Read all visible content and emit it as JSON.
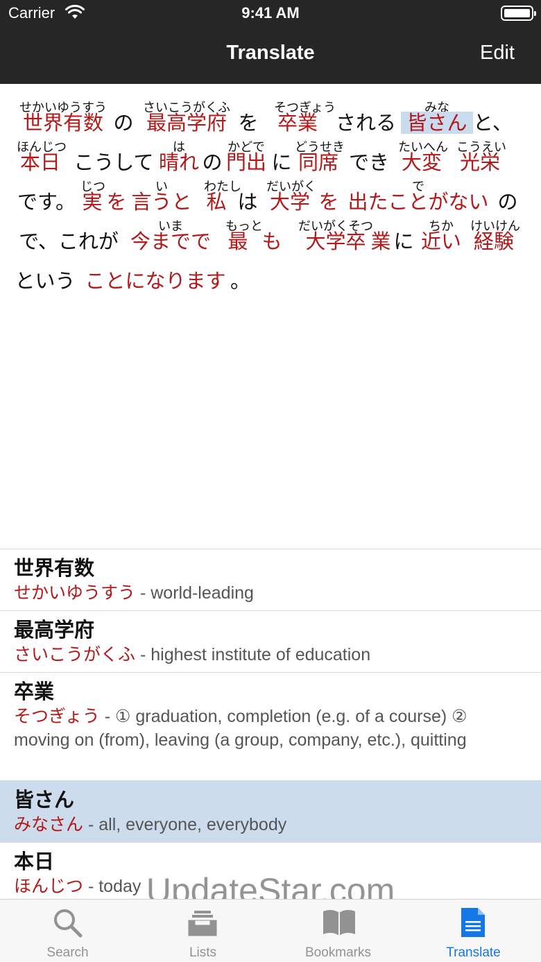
{
  "status_bar": {
    "carrier": "Carrier",
    "time": "9:41 AM"
  },
  "nav": {
    "title": "Translate",
    "edit_label": "Edit"
  },
  "passage": {
    "lines": [
      [
        {
          "text": "世界有数",
          "ruby": "せかいゆうすう",
          "kind": "word"
        },
        {
          "text": "の",
          "kind": "plain"
        },
        {
          "text": "最高学府",
          "ruby": "さいこうがくふ",
          "kind": "word"
        },
        {
          "text": "を",
          "kind": "plain"
        },
        {
          "text": "卒業",
          "ruby": "そつぎょう",
          "kind": "word"
        },
        {
          "text": "される",
          "kind": "plain"
        },
        {
          "text": "皆さん",
          "ruby": "みな",
          "kind": "word",
          "highlight": true
        },
        {
          "text": "と、",
          "kind": "plain"
        }
      ],
      [
        {
          "text": "本日",
          "ruby": "ほんじつ",
          "kind": "word"
        },
        {
          "text": "こうして",
          "kind": "plain"
        },
        {
          "text": "晴れ",
          "ruby": "は",
          "kind": "word"
        },
        {
          "text": "の",
          "kind": "plain"
        },
        {
          "text": "門出",
          "ruby": "かどで",
          "kind": "word"
        },
        {
          "text": "に",
          "kind": "plain"
        },
        {
          "text": "同席",
          "ruby": "どうせき",
          "kind": "word"
        },
        {
          "text": "でき",
          "kind": "plain"
        },
        {
          "text": "大変",
          "ruby": "たいへん",
          "kind": "word"
        },
        {
          "text": "光栄",
          "ruby": "こうえい",
          "kind": "word"
        }
      ],
      [
        {
          "text": "です。",
          "kind": "plain"
        },
        {
          "text": "実",
          "ruby": "じつ",
          "kind": "word"
        },
        {
          "text": "を",
          "kind": "word"
        },
        {
          "text": "言うと",
          "ruby": "い",
          "kind": "word"
        },
        {
          "text": "私",
          "ruby": "わたし",
          "kind": "word"
        },
        {
          "text": "は",
          "kind": "plain"
        },
        {
          "text": "大学",
          "ruby": "だいがく",
          "kind": "word"
        },
        {
          "text": "を",
          "kind": "word"
        },
        {
          "text": "出たことがない",
          "ruby": "で",
          "kind": "word"
        },
        {
          "text": "の",
          "kind": "plain"
        }
      ],
      [
        {
          "text": "で、これが",
          "kind": "plain"
        },
        {
          "text": "今までで",
          "ruby": "いま",
          "kind": "word"
        },
        {
          "text": "最",
          "ruby": "もっと",
          "kind": "word"
        },
        {
          "text": "も",
          "kind": "word"
        },
        {
          "text": "大学卒",
          "ruby": "だいがくそつ",
          "kind": "word"
        },
        {
          "text": "業",
          "kind": "word"
        },
        {
          "text": "に",
          "kind": "plain"
        },
        {
          "text": "近い",
          "ruby": "ちか",
          "kind": "word"
        },
        {
          "text": "経験",
          "ruby": "けいけん",
          "kind": "word"
        }
      ],
      [
        {
          "text": "という",
          "kind": "plain"
        },
        {
          "text": "ことになります",
          "kind": "word"
        },
        {
          "text": "。",
          "kind": "plain"
        }
      ]
    ]
  },
  "dictionary": {
    "entries": [
      {
        "term": "世界有数",
        "reading": "せかいゆうすう",
        "meaning": " - world-leading",
        "selected": false
      },
      {
        "term": "最高学府",
        "reading": "さいこうがくふ",
        "meaning": " - highest institute of education",
        "selected": false
      },
      {
        "term": "卒業",
        "reading": "そつぎょう",
        "meaning": " - ① graduation, completion (e.g. of a course) ② moving on (from), leaving (a group, company, etc.), quitting",
        "selected": false
      },
      {
        "term": "皆さん",
        "reading": "みなさん",
        "meaning": " - all, everyone, everybody",
        "selected": true
      },
      {
        "term": "本日",
        "reading": "ほんじつ",
        "meaning": " - today",
        "selected": false
      }
    ]
  },
  "watermark": "UpdateStar.com",
  "tabs": [
    {
      "label": "Search",
      "icon": "search-icon",
      "active": false
    },
    {
      "label": "Lists",
      "icon": "tray-icon",
      "active": false
    },
    {
      "label": "Bookmarks",
      "icon": "book-icon",
      "active": false
    },
    {
      "label": "Translate",
      "icon": "document-icon",
      "active": true
    }
  ],
  "colors": {
    "nav_background": "#262626",
    "word_red": "#b41818",
    "highlight_blue": "#c9dcef",
    "selected_row": "#cddcec",
    "tab_active": "#1477e5",
    "tab_inactive": "#929292"
  }
}
